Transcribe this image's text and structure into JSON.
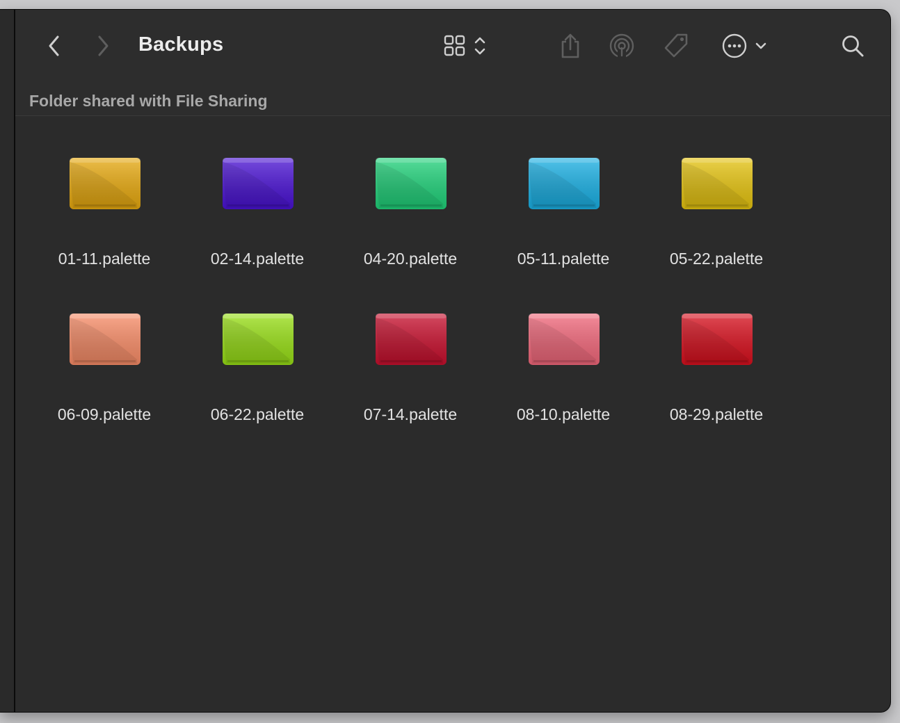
{
  "window": {
    "title": "Backups",
    "info_bar": "Folder shared with File Sharing"
  },
  "toolbar": {
    "icons": [
      "back-icon",
      "forward-icon",
      "grid-view-icon",
      "sort-chevron-icon",
      "share-icon",
      "airdrop-icon",
      "tag-icon",
      "more-icon",
      "chevron-down-icon",
      "search-icon"
    ]
  },
  "files": [
    {
      "name": "01-11.palette",
      "color": "#e7a90f"
    },
    {
      "name": "02-14.palette",
      "color": "#4a12d4"
    },
    {
      "name": "04-20.palette",
      "color": "#20d27a"
    },
    {
      "name": "05-11.palette",
      "color": "#1ab0e4"
    },
    {
      "name": "05-22.palette",
      "color": "#e6c410"
    },
    {
      "name": "06-09.palette",
      "color": "#f98d68"
    },
    {
      "name": "06-22.palette",
      "color": "#98df16"
    },
    {
      "name": "07-14.palette",
      "color": "#c8102e"
    },
    {
      "name": "08-10.palette",
      "color": "#f2687b"
    },
    {
      "name": "08-29.palette",
      "color": "#d8101e"
    }
  ]
}
